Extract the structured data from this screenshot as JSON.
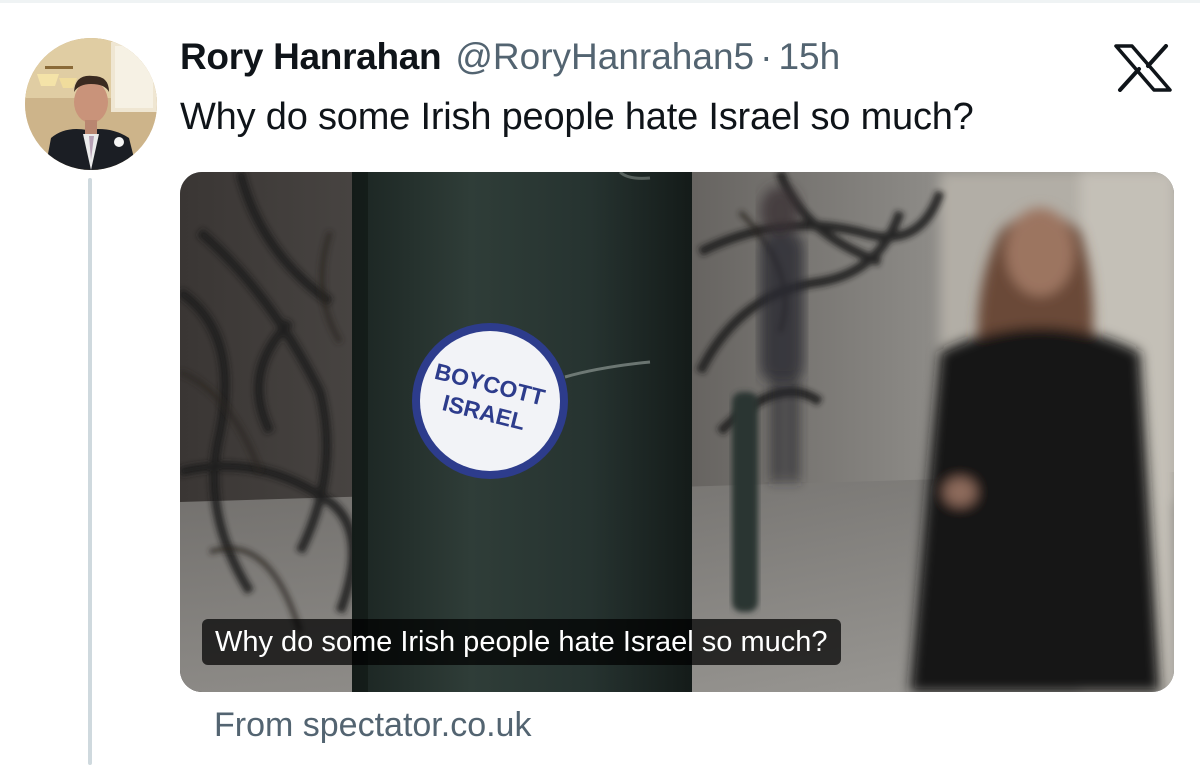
{
  "tweet": {
    "author": {
      "display_name": "Rory Hanrahan",
      "handle": "@RoryHanrahan5"
    },
    "separator": "·",
    "time": "15h",
    "text": "Why do some Irish people hate Israel so much?"
  },
  "link_card": {
    "headline": "Why do some Irish people hate Israel so much?",
    "source": "From spectator.co.uk",
    "sticker_text": [
      "BOYCOTT",
      "ISRAEL"
    ]
  },
  "icons": {
    "platform": "x-logo-icon",
    "avatar": "profile-photo"
  },
  "colors": {
    "primary_text": "#0f1419",
    "secondary_text": "#536471",
    "thread_line": "#cfd9de",
    "sticker_blue": "#2d3c8c"
  }
}
